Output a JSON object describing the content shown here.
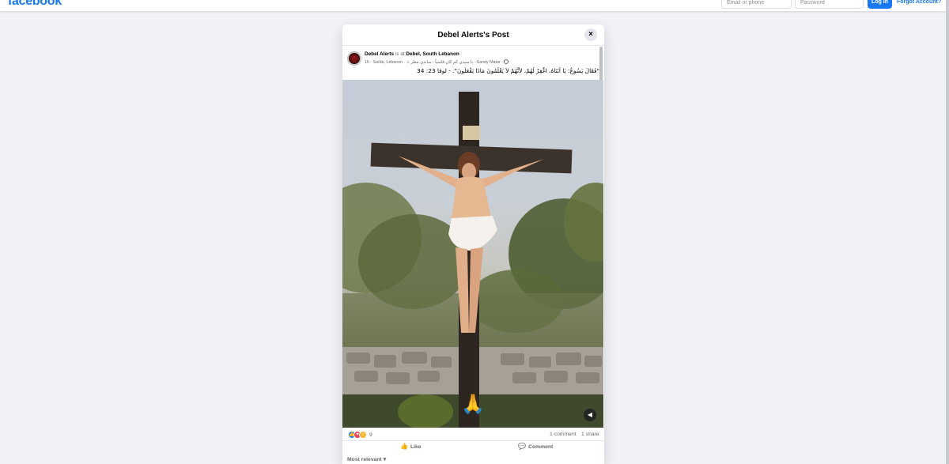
{
  "topbar": {
    "logo": "facebook",
    "email_placeholder": "Email or phone",
    "password_placeholder": "Password",
    "login_label": "Log In",
    "forgot_label": "Forgot Account?"
  },
  "modal": {
    "title": "Debel Alerts's Post",
    "close_icon": "×"
  },
  "post": {
    "author": "Debel Alerts",
    "is_at": "is at",
    "place": "Debel, South Lebanon",
    "time": "1h",
    "location": "Saïda, Lebanon",
    "song": "يا سيدي كم كان قاسياً - ساندي مطر",
    "artist": "Sandy Matar",
    "text": "\"فَقَالَ يَسُوعُ: يَا أَبَتَاهُ، اغْفِرْ لَهُمْ، لأَنَّهُمْ لاَ يَعْلَمُونَ مَاذَا يَفْعَلُونَ\". - لوقا 23: 34",
    "photo_subject": "crucifix-statue",
    "pray_emoji": "🙏"
  },
  "engagement": {
    "reaction_count": "9",
    "comments": "1 comment",
    "shares": "1 share",
    "like_label": "Like",
    "comment_label": "Comment",
    "sort_label": "Most relevant"
  },
  "colors": {
    "brand": "#1877f2",
    "background": "#f0f2f5"
  }
}
